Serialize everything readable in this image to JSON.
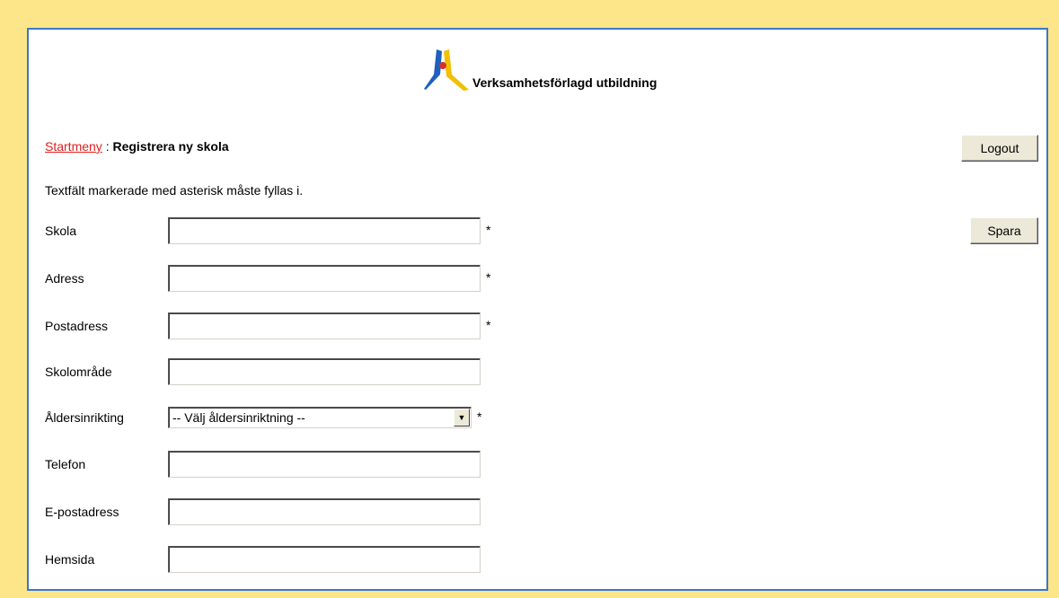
{
  "brand": {
    "name": "Verksamhetsförlagd utbildning"
  },
  "breadcrumb": {
    "link": "Startmeny",
    "separator": " : ",
    "current": "Registrera ny skola"
  },
  "buttons": {
    "logout": "Logout",
    "save": "Spara"
  },
  "info_text": "Textfält markerade med asterisk måste fyllas i.",
  "required_marker": "*",
  "fields": {
    "skola": {
      "label": "Skola",
      "value": ""
    },
    "adress": {
      "label": "Adress",
      "value": ""
    },
    "postadress": {
      "label": "Postadress",
      "value": ""
    },
    "skolomrade": {
      "label": "Skolområde",
      "value": ""
    },
    "aldersinrikting": {
      "label": "Åldersinrikting",
      "selected": "-- Välj åldersinriktning --"
    },
    "telefon": {
      "label": "Telefon",
      "value": ""
    },
    "epost": {
      "label": "E-postadress",
      "value": ""
    },
    "hemsida": {
      "label": "Hemsida",
      "value": ""
    }
  },
  "colors": {
    "page_bg": "#fde58a",
    "frame_border": "#3a78c8",
    "link": "#e02020"
  },
  "icons": {
    "dropdown": "chevron-down-icon",
    "logo": "vfu-logo-icon"
  }
}
